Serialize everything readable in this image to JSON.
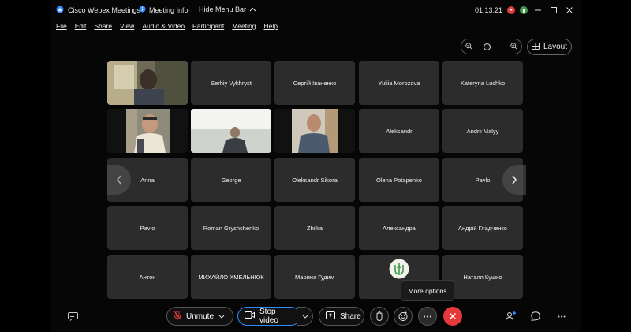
{
  "window": {
    "app_title": "Cisco Webex Meetings",
    "meeting_info_label": "Meeting Info",
    "hide_menu_label": "Hide Menu Bar",
    "timer": "01:13:21",
    "accent_red": "#e23b3b",
    "accent_green": "#3f9b4b"
  },
  "menu": {
    "items": [
      "File",
      "Edit",
      "Share",
      "View",
      "Audio & Video",
      "Participant",
      "Meeting",
      "Help"
    ]
  },
  "toolbar": {
    "layout_label": "Layout"
  },
  "participants": [
    {
      "name": "",
      "video": true
    },
    {
      "name": "Serhiy Vykhryst",
      "video": false
    },
    {
      "name": "Сергій Іваненко",
      "video": false
    },
    {
      "name": "Yuliia Morozova",
      "video": false
    },
    {
      "name": "Kateryna Luchko",
      "video": false
    },
    {
      "name": "",
      "video": true
    },
    {
      "name": "",
      "video": true
    },
    {
      "name": "",
      "video": true
    },
    {
      "name": "Aleksandr",
      "video": false
    },
    {
      "name": "Andrii Malyy",
      "video": false
    },
    {
      "name": "Anna",
      "video": false
    },
    {
      "name": "George",
      "video": false
    },
    {
      "name": "Oleksandr Sikora",
      "video": false
    },
    {
      "name": "Olena Potapenko",
      "video": false
    },
    {
      "name": "Pavlo",
      "video": false
    },
    {
      "name": "Pavlo",
      "video": false
    },
    {
      "name": "Roman Gryshchenko",
      "video": false
    },
    {
      "name": "Zhilka",
      "video": false
    },
    {
      "name": "Александра",
      "video": false
    },
    {
      "name": "Андрій Гладченко",
      "video": false
    },
    {
      "name": "Антон",
      "video": false
    },
    {
      "name": "МИХАЙЛО ХМЕЛЬНЮК",
      "video": false
    },
    {
      "name": "Марина Гудим",
      "video": false
    },
    {
      "name": "",
      "video": false
    },
    {
      "name": "Наталя Кушко",
      "video": false
    }
  ],
  "tooltip": {
    "text": "More options"
  },
  "controls": {
    "unmute_label": "Unmute",
    "stop_video_label": "Stop video",
    "share_label": "Share",
    "end_color": "#e5393b"
  }
}
